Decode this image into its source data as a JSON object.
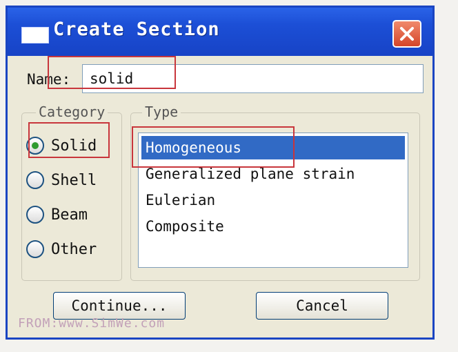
{
  "window": {
    "title": "Create Section",
    "close_icon": "close-icon"
  },
  "name": {
    "label": "Name:",
    "value": "solid"
  },
  "category": {
    "title": "Category",
    "options": [
      {
        "label": "Solid",
        "selected": true
      },
      {
        "label": "Shell",
        "selected": false
      },
      {
        "label": "Beam",
        "selected": false
      },
      {
        "label": "Other",
        "selected": false
      }
    ]
  },
  "type": {
    "title": "Type",
    "items": [
      {
        "label": "Homogeneous",
        "selected": true
      },
      {
        "label": "Generalized plane strain",
        "selected": false
      },
      {
        "label": "Eulerian",
        "selected": false
      },
      {
        "label": "Composite",
        "selected": false
      }
    ]
  },
  "buttons": {
    "continue_label": "Continue...",
    "cancel_label": "Cancel"
  },
  "watermark": "FROM:www.SimWe.com",
  "colors": {
    "title_bar": "#1c4fd6",
    "selection": "#316ac5",
    "annotation": "#c8353b"
  }
}
